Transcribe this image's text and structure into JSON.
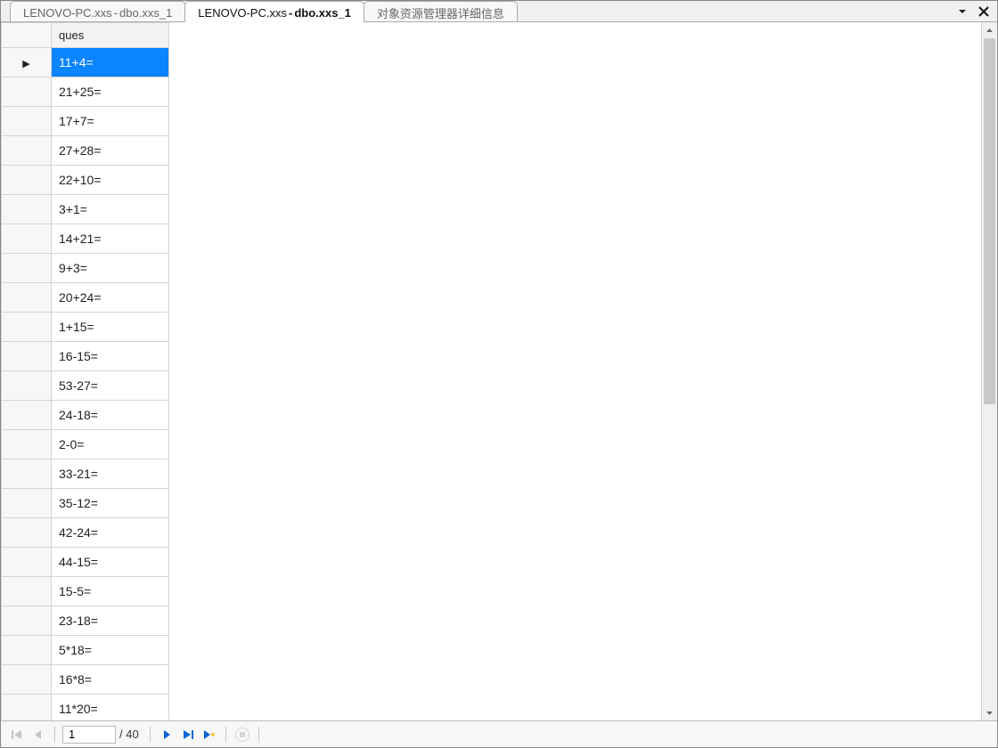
{
  "tabs": [
    {
      "prefix": "LENOVO-PC.xxs",
      "sep": " - ",
      "suffix": "dbo.xxs_1",
      "active": false
    },
    {
      "prefix": "LENOVO-PC.xxs",
      "sep": " - ",
      "suffix": "dbo.xxs_1",
      "active": true
    },
    {
      "prefix": "对象资源管理器详细信息",
      "sep": "",
      "suffix": "",
      "active": false
    }
  ],
  "grid": {
    "column_header": "ques",
    "selected_index": 0,
    "rows": [
      "11+4=",
      "21+25=",
      "17+7=",
      "27+28=",
      "22+10=",
      "3+1=",
      "14+21=",
      "9+3=",
      "20+24=",
      "1+15=",
      "16-15=",
      "53-27=",
      "24-18=",
      "2-0=",
      "33-21=",
      "35-12=",
      "42-24=",
      "44-15=",
      "15-5=",
      "23-18=",
      "5*18=",
      "16*8=",
      "11*20="
    ]
  },
  "footer": {
    "current": "1",
    "total_label": "/ 40"
  },
  "colors": {
    "selection": "#0a84ff",
    "next_arrow": "#0a66d6",
    "new_star": "#f0b400"
  }
}
